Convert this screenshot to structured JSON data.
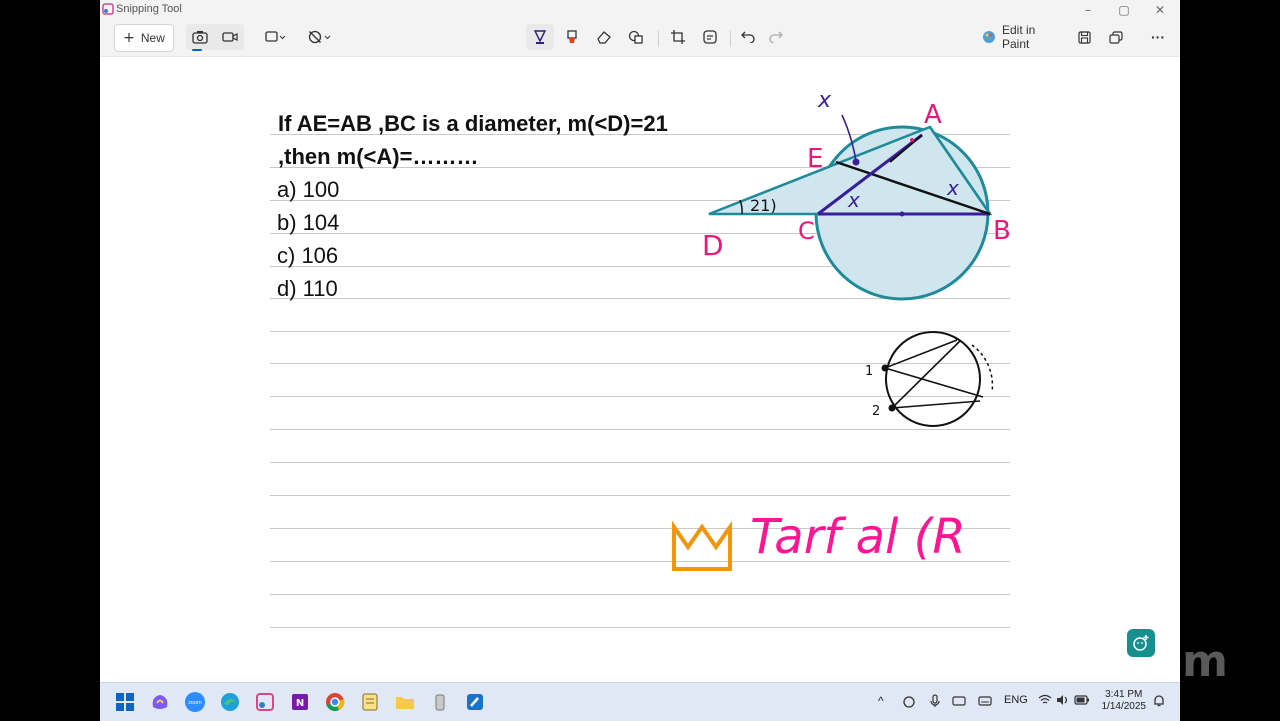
{
  "window": {
    "title": "Snipping Tool"
  },
  "titlebar": {
    "minimize": "–",
    "restore": "▢",
    "close": "✕"
  },
  "toolbar": {
    "new_label": "New",
    "edit_in_paint": "Edit in Paint",
    "more": "···"
  },
  "question": {
    "line1": "If AE=AB ,BC is a diameter, m(<D)=21",
    "line2": ",then m(<A)=………",
    "options": [
      "a) 100",
      "b) 104",
      "c) 106",
      "d) 110"
    ]
  },
  "diagram": {
    "labels": {
      "A": "A",
      "B": "B",
      "C": "C",
      "D": "D",
      "E": "E",
      "x_top": "x",
      "x_mid": "x",
      "x_right": "x",
      "angle_d": "21)",
      "small1": "1",
      "small2": "2"
    }
  },
  "watermark": {
    "text": "Tarf al (R"
  },
  "taskbar": {
    "lang": "ENG",
    "time": "3:41 PM",
    "date": "1/14/2025"
  },
  "colors": {
    "teal": "#1f8a99",
    "purple": "#3a1d9a",
    "pink": "#e6197a",
    "orange": "#f2950f"
  }
}
